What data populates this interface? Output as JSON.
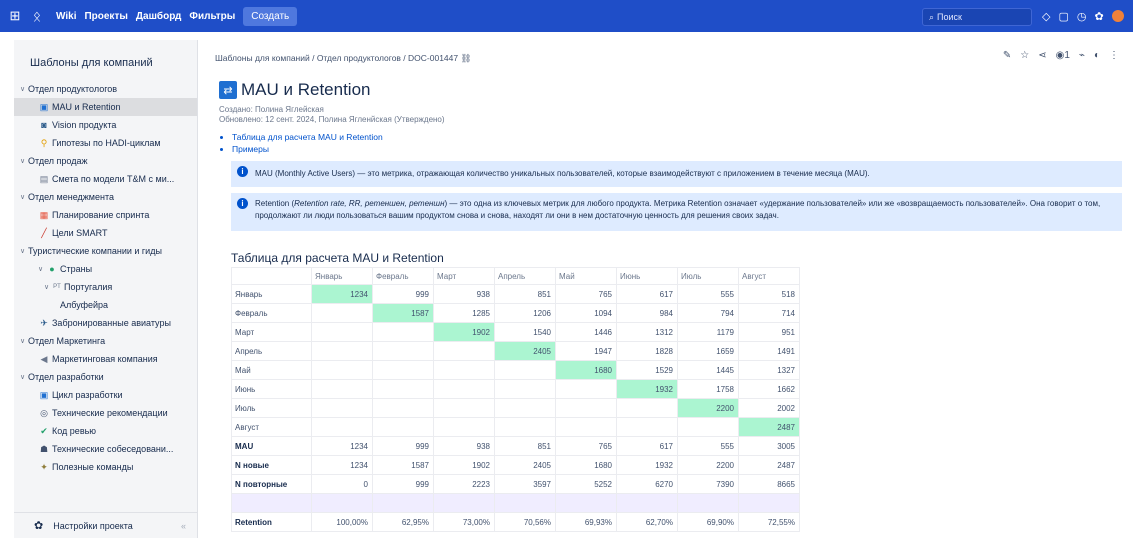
{
  "topbar": {
    "nav": [
      "Wiki",
      "Проекты",
      "Дашборд",
      "Фильтры"
    ],
    "create_label": "Создать",
    "search_placeholder": "Поиск"
  },
  "sidebar": {
    "title": "Шаблоны для компаний",
    "items": [
      {
        "label": "Отдел продуктологов",
        "level": 0,
        "caret": "∨",
        "icon": ""
      },
      {
        "label": "MAU и Retention",
        "level": 1,
        "icon": "▣",
        "iconColor": "#1f6fd1",
        "active": true
      },
      {
        "label": "Vision продукта",
        "level": 1,
        "icon": "◙",
        "iconColor": "#2a5a8a"
      },
      {
        "label": "Гипотезы по HADI-циклам",
        "level": 1,
        "icon": "⚲",
        "iconColor": "#e3a008"
      },
      {
        "label": "Отдел продаж",
        "level": 0,
        "caret": "∨",
        "icon": ""
      },
      {
        "label": "Смета по модели T&M с ми...",
        "level": 1,
        "icon": "▤",
        "iconColor": "#6b778c"
      },
      {
        "label": "Отдел менеджмента",
        "level": 0,
        "caret": "∨",
        "icon": ""
      },
      {
        "label": "Планирование спринта",
        "level": 1,
        "icon": "▦",
        "iconColor": "#e5533d"
      },
      {
        "label": "Цели SMART",
        "level": 1,
        "icon": "╱",
        "iconColor": "#c9372c"
      },
      {
        "label": "Туристические компании и гиды",
        "level": 0,
        "caret": "∨",
        "icon": ""
      },
      {
        "label": "Страны",
        "level": 1,
        "caret": "∨",
        "icon": "●",
        "iconColor": "#22a06b"
      },
      {
        "label": "Португалия",
        "level": 2,
        "caret": "∨",
        "icon": "PT",
        "iconColor": "#6b778c"
      },
      {
        "label": "Албуфейра",
        "level": 3,
        "icon": ""
      },
      {
        "label": "Забронированные авиатуры",
        "level": 1,
        "icon": "✈",
        "iconColor": "#2a5a8a"
      },
      {
        "label": "Отдел Маркетинга",
        "level": 0,
        "caret": "∨",
        "icon": ""
      },
      {
        "label": "Маркетинговая компания",
        "level": 1,
        "icon": "◀",
        "iconColor": "#6b778c"
      },
      {
        "label": "Отдел разработки",
        "level": 0,
        "caret": "∨",
        "icon": ""
      },
      {
        "label": "Цикл разработки",
        "level": 1,
        "icon": "▣",
        "iconColor": "#1f6fd1"
      },
      {
        "label": "Технические рекомендации",
        "level": 1,
        "icon": "◎",
        "iconColor": "#42526e"
      },
      {
        "label": "Код ревью",
        "level": 1,
        "icon": "✔",
        "iconColor": "#22a06b"
      },
      {
        "label": "Технические собеседовани...",
        "level": 1,
        "icon": "☗",
        "iconColor": "#42526e"
      },
      {
        "label": "Полезные команды",
        "level": 1,
        "icon": "✦",
        "iconColor": "#8f7d3a"
      }
    ],
    "footer_label": "Настройки проекта"
  },
  "page": {
    "breadcrumb": "Шаблоны для компаний / Отдел продуктологов / DOC-001447",
    "watch_count": "1",
    "title": "MAU и Retention",
    "created": "Создано: Полина Яглейская",
    "updated": "Обновлено: 12 сент. 2024, Полина Ягленйская  (Утверждено)",
    "toc": [
      "Таблица для расчета MAU и Retention",
      "Примеры"
    ],
    "info1": "MAU (Monthly Active Users) — это метрика, отражающая количество уникальных пользователей, которые взаимодействуют с приложением в течение месяца (MAU).",
    "info2_a": "Retention (",
    "info2_em": "Retention rate, RR, ретеншен, ретеншн",
    "info2_b": ") — это одна из ключевых метрик для любого продукта. Метрика Retention означает «удержание пользователей» или же «возвращаемость пользователей». Она говорит о том, продолжают ли люди пользоваться вашим продуктом снова и снова, находят ли они в нем достаточную ценность для решения своих задач.",
    "table_title": "Таблица для расчета MAU и Retention"
  },
  "table": {
    "columns": [
      "Январь",
      "Февраль",
      "Март",
      "Апрель",
      "Май",
      "Июнь",
      "Июль",
      "Август"
    ],
    "cohorts": [
      {
        "label": "Январь",
        "cells": [
          "1234",
          "999",
          "938",
          "851",
          "765",
          "617",
          "555",
          "518"
        ]
      },
      {
        "label": "Февраль",
        "cells": [
          "",
          "1587",
          "1285",
          "1206",
          "1094",
          "984",
          "794",
          "714"
        ]
      },
      {
        "label": "Март",
        "cells": [
          "",
          "",
          "1902",
          "1540",
          "1446",
          "1312",
          "1179",
          "951"
        ]
      },
      {
        "label": "Апрель",
        "cells": [
          "",
          "",
          "",
          "2405",
          "1947",
          "1828",
          "1659",
          "1491"
        ]
      },
      {
        "label": "Май",
        "cells": [
          "",
          "",
          "",
          "",
          "1680",
          "1529",
          "1445",
          "1327"
        ]
      },
      {
        "label": "Июнь",
        "cells": [
          "",
          "",
          "",
          "",
          "",
          "1932",
          "1758",
          "1662"
        ]
      },
      {
        "label": "Июль",
        "cells": [
          "",
          "",
          "",
          "",
          "",
          "",
          "2200",
          "2002"
        ]
      },
      {
        "label": "Август",
        "cells": [
          "",
          "",
          "",
          "",
          "",
          "",
          "",
          "2487"
        ]
      }
    ],
    "totals": [
      {
        "label": "MAU",
        "cells": [
          "1234",
          "999",
          "938",
          "851",
          "765",
          "617",
          "555",
          "3005"
        ]
      },
      {
        "label": "N новые",
        "cells": [
          "1234",
          "1587",
          "1902",
          "2405",
          "1680",
          "1932",
          "2200",
          "2487"
        ]
      },
      {
        "label": "N повторные",
        "cells": [
          "0",
          "999",
          "2223",
          "3597",
          "5252",
          "6270",
          "7390",
          "8665"
        ]
      }
    ],
    "retention": {
      "label": "Retention",
      "cells": [
        "100,00%",
        "62,95%",
        "73,00%",
        "70,56%",
        "69,93%",
        "62,70%",
        "69,90%",
        "72,55%"
      ]
    }
  },
  "colors": {
    "topbar": "#1f4ec8",
    "highlight": "#abf5d1",
    "info": "#deebff"
  }
}
